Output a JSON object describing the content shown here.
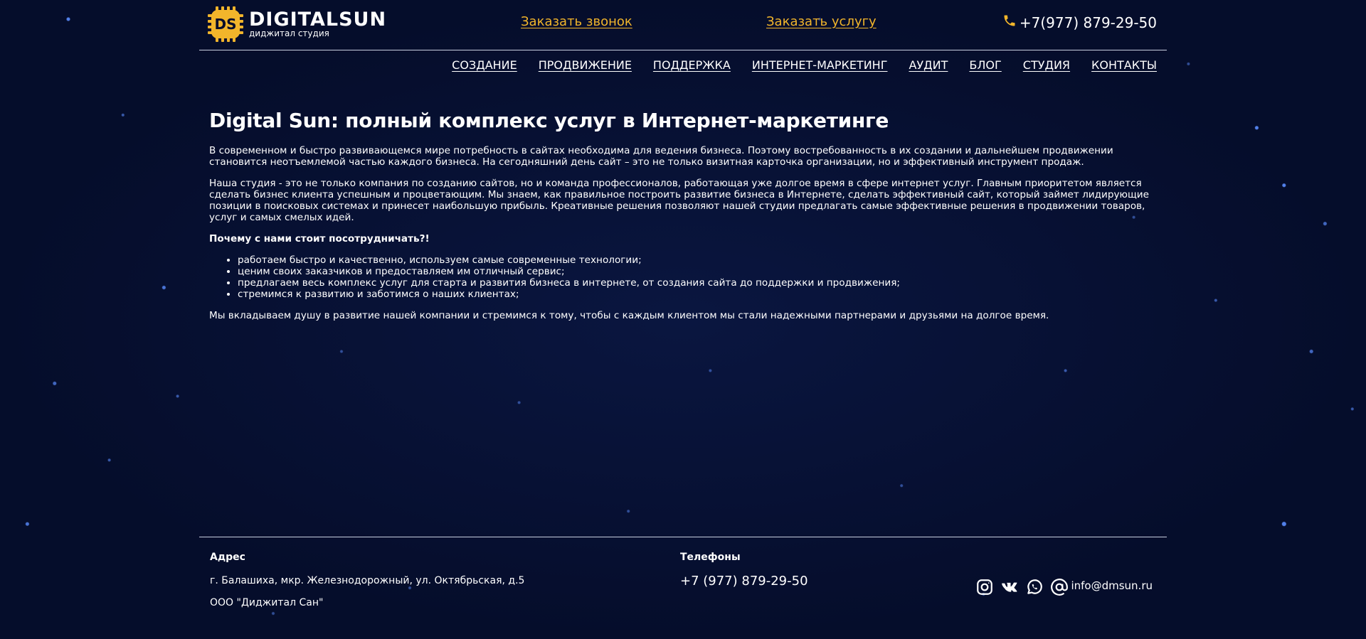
{
  "header": {
    "logo_title": "DIGITALSUN",
    "logo_subtitle": "диджитал студия",
    "logo_badge_letters": "DS",
    "callback_link": "Заказать звонок",
    "order_link": "Заказать услугу",
    "phone": "+7(977) 879-29-50"
  },
  "nav": {
    "items": [
      {
        "label": "СОЗДАНИЕ"
      },
      {
        "label": "ПРОДВИЖЕНИЕ"
      },
      {
        "label": "ПОДДЕРЖКА"
      },
      {
        "label": "ИНТЕРНЕТ-МАРКЕТИНГ"
      },
      {
        "label": "АУДИТ"
      },
      {
        "label": "БЛОГ"
      },
      {
        "label": "СТУДИЯ"
      },
      {
        "label": "КОНТАКТЫ"
      }
    ]
  },
  "content": {
    "title": "Digital Sun: полный комплекс услуг в Интернет-маркетинге",
    "para1": "В современном и быстро развивающемся мире потребность в сайтах необходима для ведения бизнеса. Поэтому востребованность в их создании и дальнейшем продвижении становится неотъемлемой частью каждого бизнеса. На сегодняшний день сайт – это не только визитная карточка организации, но и эффективный инструмент продаж.",
    "para2": "Наша студия - это не только компания по созданию сайтов, но и команда профессионалов, работающая уже долгое время в сфере интернет услуг. Главным приоритетом является сделать бизнес клиента успешным и процветающим. Мы знаем, как правильное построить развитие бизнеса в Интернете, сделать эффективный сайт, который займет лидирующие позиции в поисковых системах и принесет наибольшую прибыль. Креативные решения позволяют нашей студии предлагать самые эффективные решения в продвижении товаров, услуг и самых смелых идей.",
    "why_heading": "Почему с нами стоит посотрудничать?!",
    "bullets": [
      "работаем быстро и качественно, используем самые современные технологии;",
      "ценим своих заказчиков и предоставляем им отличный сервис;",
      "предлагаем весь комплекс услуг для старта и развития бизнеса в интернете, от создания сайта до поддержки и продвижения;",
      "стремимся к развитию и заботимся о наших клиентах;"
    ],
    "closing": "Мы вкладываем душу в развитие нашей компании и стремимся к тому, чтобы с каждым клиентом мы стали надежными партнерами и друзьями на долгое время."
  },
  "footer": {
    "address_heading": "Адрес",
    "address": "г. Балашиха, мкр. Железнодорожный, ул. Октябрьская, д.5",
    "company": "ООО \"Диджитал Сан\"",
    "phones_heading": "Телефоны",
    "phone": "+7 (977) 879-29-50",
    "email": "info@dmsun.ru",
    "social_icons": [
      "instagram-icon",
      "vk-icon",
      "whatsapp-icon",
      "at-sign-icon"
    ]
  },
  "colors": {
    "background": "#050d2b",
    "accent": "#f2b52b",
    "text": "#ffffff"
  }
}
